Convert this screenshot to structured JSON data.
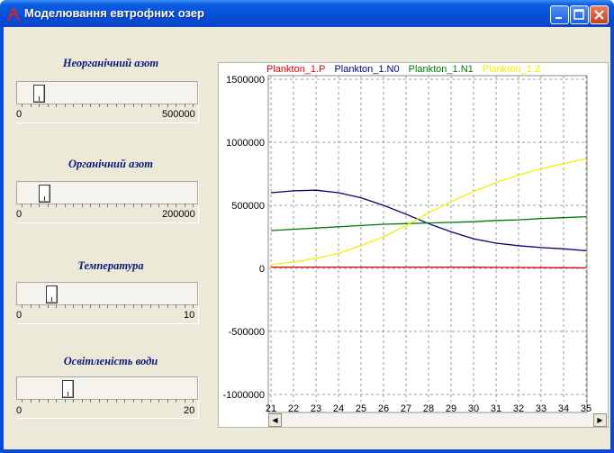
{
  "window": {
    "title": "Моделювання евтрофних озер"
  },
  "sliders": [
    {
      "label": "Неорганічний азот",
      "min": "0",
      "max": "500000",
      "fraction": 0.07
    },
    {
      "label": "Органічний азот",
      "min": "0",
      "max": "200000",
      "fraction": 0.1
    },
    {
      "label": "Температура",
      "min": "0",
      "max": "10",
      "fraction": 0.15
    },
    {
      "label": "Освітленість води",
      "min": "0",
      "max": "20",
      "fraction": 0.25
    }
  ],
  "chart_data": {
    "type": "line",
    "legend": [
      "Plankton_1.P",
      "Plankton_1.N0",
      "Plankton_1.N1",
      "Plankton_1.Z"
    ],
    "colors": [
      "#e00000",
      "#00007a",
      "#007a00",
      "#f0f000"
    ],
    "y_ticks": [
      "1500000",
      "1000000",
      "500000",
      "0",
      "-500000",
      "-1000000"
    ],
    "x_ticks": [
      "21",
      "22",
      "23",
      "24",
      "25",
      "26",
      "27",
      "28",
      "29",
      "30",
      "31",
      "32",
      "33",
      "34",
      "35"
    ],
    "xlim": [
      21,
      35
    ],
    "ylim": [
      -1000000,
      1500000
    ],
    "grid": true,
    "series": [
      {
        "name": "Plankton_1.P",
        "x": [
          21,
          22,
          23,
          24,
          25,
          26,
          27,
          28,
          29,
          30,
          31,
          32,
          33,
          34,
          35
        ],
        "values": [
          10000,
          10000,
          10000,
          10000,
          10000,
          10000,
          10000,
          10000,
          10000,
          9000,
          8000,
          7000,
          6000,
          5000,
          4000
        ]
      },
      {
        "name": "Plankton_1.N0",
        "x": [
          21,
          22,
          23,
          24,
          25,
          26,
          27,
          28,
          29,
          30,
          31,
          32,
          33,
          34,
          35
        ],
        "values": [
          600000,
          615000,
          620000,
          600000,
          560000,
          500000,
          430000,
          355000,
          290000,
          235000,
          200000,
          180000,
          165000,
          155000,
          140000
        ]
      },
      {
        "name": "Plankton_1.N1",
        "x": [
          21,
          22,
          23,
          24,
          25,
          26,
          27,
          28,
          29,
          30,
          31,
          32,
          33,
          34,
          35
        ],
        "values": [
          300000,
          310000,
          320000,
          330000,
          340000,
          350000,
          355000,
          360000,
          365000,
          370000,
          380000,
          385000,
          395000,
          402000,
          410000
        ]
      },
      {
        "name": "Plankton_1.Z",
        "x": [
          21,
          22,
          23,
          24,
          25,
          26,
          27,
          28,
          29,
          30,
          31,
          32,
          33,
          34,
          35
        ],
        "values": [
          30000,
          50000,
          80000,
          120000,
          180000,
          250000,
          340000,
          440000,
          530000,
          610000,
          680000,
          740000,
          790000,
          830000,
          870000
        ]
      }
    ]
  }
}
